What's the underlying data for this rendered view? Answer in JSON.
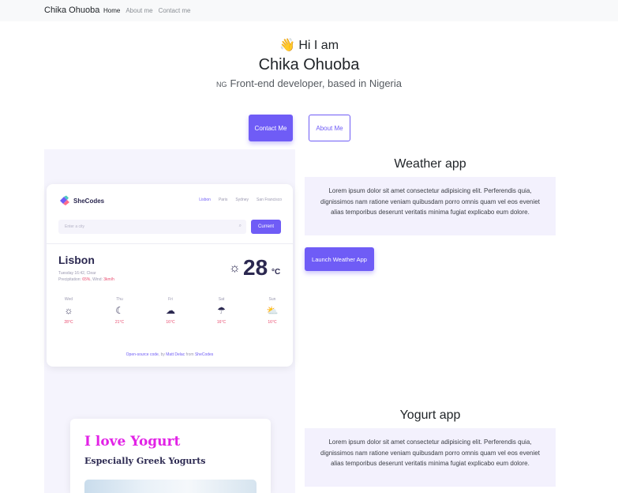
{
  "navbar": {
    "brand": "Chika Ohuoba",
    "links": [
      {
        "label": "Home",
        "active": true
      },
      {
        "label": "About me",
        "active": false
      },
      {
        "label": "Contact me",
        "active": false
      }
    ]
  },
  "hero": {
    "wave_emoji": "👋",
    "greeting": "Hi I am",
    "name": "Chika Ohuoba",
    "flag_code": "NG",
    "role": "Front-end developer, based in Nigeria",
    "contact_button": "Contact Me",
    "about_button": "About Me"
  },
  "weather_preview": {
    "brand": "SheCodes",
    "cities": [
      "Lisbon",
      "Paris",
      "Sydney",
      "San Francisco"
    ],
    "active_city": "Lisbon",
    "search_placeholder": "Enter a city",
    "current_button": "Current",
    "city": "Lisbon",
    "date_line": "Tuesday 16:42, Clear",
    "precip_label": "Precipitation: ",
    "precip_value": "65%",
    "wind_label": ", Wind: ",
    "wind_value": "3km/h",
    "temperature": "28",
    "unit": "°C",
    "forecast": [
      {
        "day": "Wed",
        "icon": "☼",
        "temp": "28°C"
      },
      {
        "day": "Thu",
        "icon": "☾",
        "temp": "21°C"
      },
      {
        "day": "Fri",
        "icon": "☁",
        "temp": "16°C"
      },
      {
        "day": "Sat",
        "icon": "☂",
        "temp": "16°C"
      },
      {
        "day": "Sun",
        "icon": "⛅",
        "temp": "16°C"
      }
    ],
    "footer_prefix": "Open-source code",
    "footer_by": ", by ",
    "footer_author": "Matt Delac",
    "footer_from": " from ",
    "footer_org": "SheCodes"
  },
  "yogurt_preview": {
    "title": "I love Yogurt",
    "subtitle": "Especially Greek Yogurts"
  },
  "projects": [
    {
      "title": "Weather app",
      "description": "Lorem ipsum dolor sit amet consectetur adipisicing elit. Perferendis quia, dignissimos nam ratione veniam quibusdam porro omnis quam vel eos eveniet alias temporibus deserunt veritatis minima fugiat explicabo eum dolore.",
      "button": "Launch Weather App"
    },
    {
      "title": "Yogurt app",
      "description": "Lorem ipsum dolor sit amet consectetur adipisicing elit. Perferendis quia, dignissimos nam ratione veniam quibusdam porro omnis quam vel eos eveniet alias temporibus deserunt veritatis minima fugiat explicabo eum dolore."
    }
  ],
  "colors": {
    "accent": "#6f5cf6",
    "panel": "#f3f1fd",
    "yogurt_title": "#e222e6",
    "forecast_temp": "#e94a6e"
  }
}
